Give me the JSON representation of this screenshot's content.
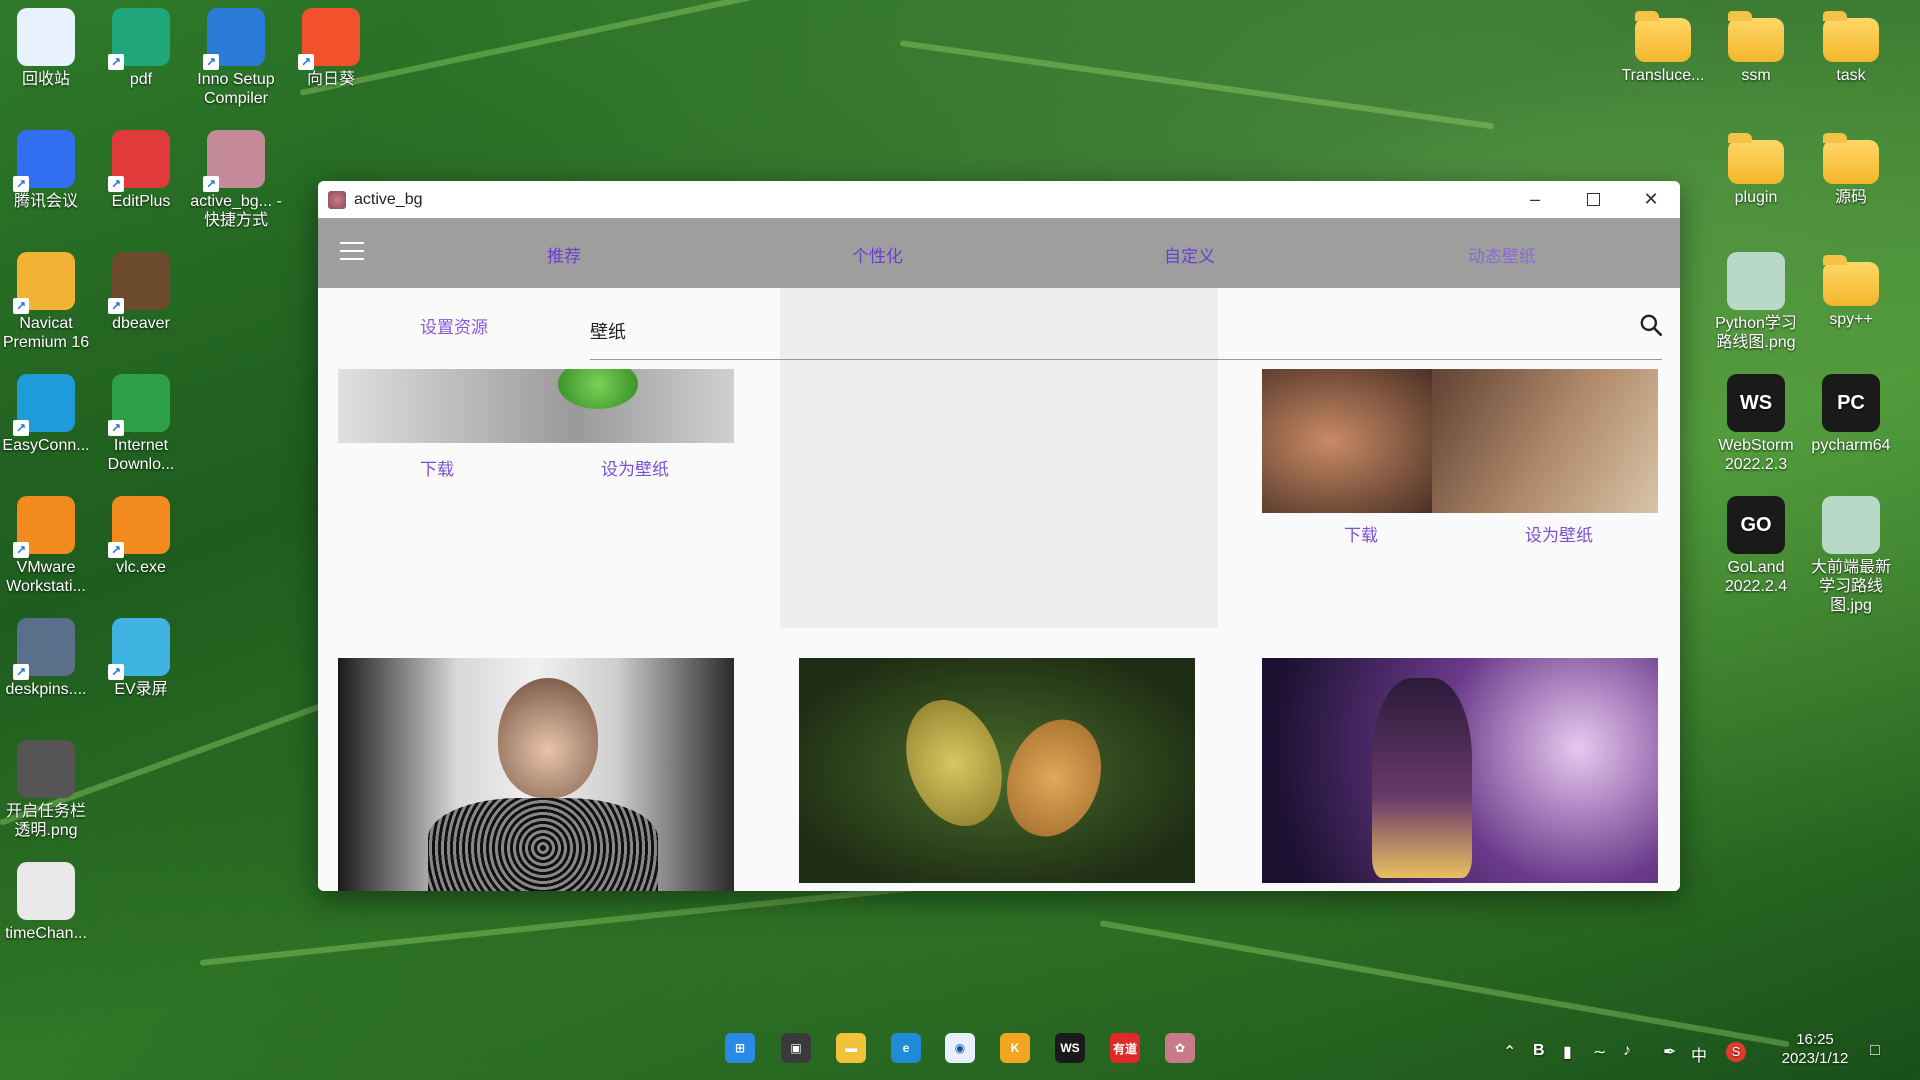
{
  "desktop_left": [
    {
      "label": "回收站",
      "icon": "recycle-bin-icon",
      "color": "#e8f2ff"
    },
    {
      "label": "pdf",
      "icon": "pdf-icon",
      "color": "#1fa67a"
    },
    {
      "label": "Inno Setup Compiler",
      "icon": "inno-setup-icon",
      "color": "#2b7bd8"
    },
    {
      "label": "向日葵",
      "icon": "sunlogin-icon",
      "color": "#f2522b"
    },
    {
      "label": "腾讯会议",
      "icon": "tencent-meeting-icon",
      "color": "#2f6ff0"
    },
    {
      "label": "EditPlus",
      "icon": "editplus-icon",
      "color": "#e03a3a"
    },
    {
      "label": "active_bg... - 快捷方式",
      "icon": "active-bg-shortcut-icon",
      "color": "#c58a9a"
    },
    {
      "label": "Navicat Premium 16",
      "icon": "navicat-icon",
      "color": "#f2b233"
    },
    {
      "label": "dbeaver",
      "icon": "dbeaver-icon",
      "color": "#6b4a2e"
    },
    {
      "label": "EasyConn...",
      "icon": "easyconnect-icon",
      "color": "#1e9bd8"
    },
    {
      "label": "Internet Downlo...",
      "icon": "idm-icon",
      "color": "#2ea04a"
    },
    {
      "label": "VMware Workstati...",
      "icon": "vmware-icon",
      "color": "#f28a1e"
    },
    {
      "label": "vlc.exe",
      "icon": "vlc-icon",
      "color": "#f28a1e"
    },
    {
      "label": "deskpins....",
      "icon": "deskpins-icon",
      "color": "#5a6f8a"
    },
    {
      "label": "EV录屏",
      "icon": "ev-recorder-icon",
      "color": "#3fb4e0"
    },
    {
      "label": "开启任务栏透明.png",
      "icon": "image-file-icon",
      "color": "#555"
    },
    {
      "label": "timeChan...",
      "icon": "timechange-icon",
      "color": "#e8e8e8"
    }
  ],
  "desktop_right": [
    {
      "label": "Transluce...",
      "icon": "folder-icon"
    },
    {
      "label": "ssm",
      "icon": "folder-icon"
    },
    {
      "label": "task",
      "icon": "folder-icon"
    },
    {
      "label": "plugin",
      "icon": "folder-icon"
    },
    {
      "label": "源码",
      "icon": "folder-icon"
    },
    {
      "label": "Python学习路线图.png",
      "icon": "image-file-icon"
    },
    {
      "label": "spy++",
      "icon": "folder-icon"
    },
    {
      "label": "WebStorm 2022.2.3",
      "icon": "webstorm-icon"
    },
    {
      "label": "pycharm64",
      "icon": "pycharm-icon"
    },
    {
      "label": "GoLand 2022.2.4",
      "icon": "goland-icon"
    },
    {
      "label": "大前端最新学习路线图.jpg",
      "icon": "image-file-icon"
    }
  ],
  "window": {
    "title": "active_bg",
    "nav_tabs": [
      "推荐",
      "个性化",
      "自定义",
      "动态壁纸"
    ],
    "resource_link": "设置资源",
    "search_value": "壁纸",
    "download_label": "下载",
    "set_wallpaper_label": "设为壁纸"
  },
  "taskbar": {
    "apps": [
      "start-icon",
      "task-view-icon",
      "file-explorer-icon",
      "edge-icon",
      "app-blue-icon",
      "app-yellow-icon",
      "webstorm-icon",
      "youdao-icon",
      "active-bg-icon"
    ],
    "tray_ime": "中",
    "time": "16:25",
    "date": "2023/1/12"
  }
}
